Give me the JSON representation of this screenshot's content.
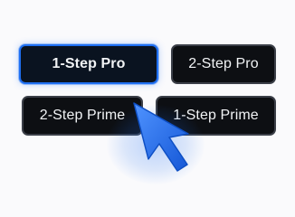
{
  "options": [
    {
      "label": "1-Step Pro",
      "selected": true
    },
    {
      "label": "2-Step Pro",
      "selected": false
    },
    {
      "label": "2-Step Prime",
      "selected": false
    },
    {
      "label": "1-Step Prime",
      "selected": false
    }
  ],
  "colors": {
    "accent": "#1f6ff2",
    "button_bg": "#0d0f13",
    "text": "#f1f3f5",
    "page_bg": "#fafafc"
  },
  "icons": {
    "cursor": "mouse-pointer-icon"
  }
}
